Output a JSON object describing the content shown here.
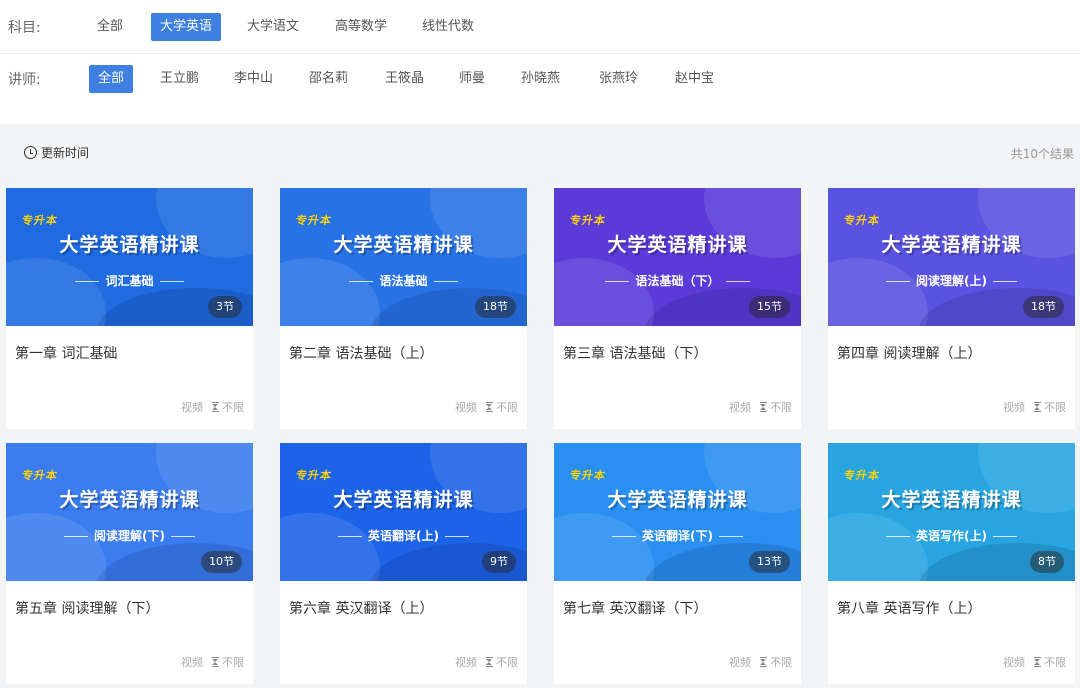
{
  "filters": {
    "subject_label": "科目:",
    "subjects": [
      "全部",
      "大学英语",
      "大学语文",
      "高等数学",
      "线性代数"
    ],
    "subject_active": "大学英语",
    "teacher_label": "讲师:",
    "teachers": [
      "全部",
      "王立鹏",
      "李中山",
      "邵名莉",
      "王筱晶",
      "师曼",
      "孙晓燕",
      "张燕玲",
      "赵中宝"
    ],
    "teacher_active": "全部"
  },
  "toolbar": {
    "sort_label": "更新时间",
    "result_count": "共10个结果"
  },
  "colors": {
    "accent": "#3f7fe0",
    "page_bg": "#f3f4f6"
  },
  "cards": [
    {
      "brand": "专升本",
      "course": "大学英语精讲课",
      "subtitle": "词汇基础",
      "lessons": "3节",
      "title": "第一章 词汇基础",
      "type": "视频",
      "limit": "不限",
      "bg": "#1f6be0"
    },
    {
      "brand": "专升本",
      "course": "大学英语精讲课",
      "subtitle": "语法基础",
      "lessons": "18节",
      "title": "第二章 语法基础（上）",
      "type": "视频",
      "limit": "不限",
      "bg": "#2773e6"
    },
    {
      "brand": "专升本",
      "course": "大学英语精讲课",
      "subtitle": "语法基础（下）",
      "lessons": "15节",
      "title": "第三章 语法基础（下）",
      "type": "视频",
      "limit": "不限",
      "bg": "#5a3bd8"
    },
    {
      "brand": "专升本",
      "course": "大学英语精讲课",
      "subtitle": "阅读理解(上)",
      "lessons": "18节",
      "title": "第四章 阅读理解（上）",
      "type": "视频",
      "limit": "不限",
      "bg": "#5a52e0"
    },
    {
      "brand": "专升本",
      "course": "大学英语精讲课",
      "subtitle": "阅读理解(下)",
      "lessons": "10节",
      "title": "第五章 阅读理解（下）",
      "type": "视频",
      "limit": "不限",
      "bg": "#3b7df0"
    },
    {
      "brand": "专升本",
      "course": "大学英语精讲课",
      "subtitle": "英语翻译(上)",
      "lessons": "9节",
      "title": "第六章 英汉翻译（上）",
      "type": "视频",
      "limit": "不限",
      "bg": "#1d63e8"
    },
    {
      "brand": "专升本",
      "course": "大学英语精讲课",
      "subtitle": "英语翻译(下)",
      "lessons": "13节",
      "title": "第七章 英汉翻译（下）",
      "type": "视频",
      "limit": "不限",
      "bg": "#2a8ff0"
    },
    {
      "brand": "专升本",
      "course": "大学英语精讲课",
      "subtitle": "英语写作(上)",
      "lessons": "8节",
      "title": "第八章 英语写作（上）",
      "type": "视频",
      "limit": "不限",
      "bg": "#28a5e0"
    }
  ]
}
